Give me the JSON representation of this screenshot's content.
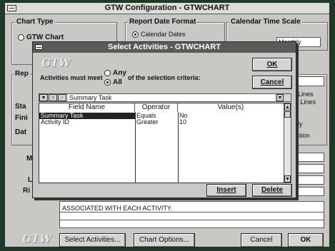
{
  "main_window": {
    "title": "GTW Configuration - GTWCHART",
    "chart_type": {
      "label": "Chart Type",
      "option1": "GTW Chart"
    },
    "report_date_format": {
      "label": "Report Date Format",
      "option1": "Calendar Dates"
    },
    "calendar_time_scale": {
      "label": "Calendar Time Scale",
      "time_units_value": "Monthly"
    },
    "partial_labels": {
      "rep": "Rep",
      "sta": "Sta",
      "fin": "Fini",
      "dat": "Dat",
      "ma": "Ma",
      "l": "L",
      "ri": "Ri",
      "lines": "Lines",
      "id_lines": "d Lines",
      "ly": "ly",
      "ation": "ation"
    },
    "note_text": "ASSOCIATED WITH EACH ACTIVITY.",
    "buttons": {
      "select_activities": "Select Activities...",
      "chart_options": "Chart Options...",
      "cancel": "Cancel",
      "ok": "OK"
    },
    "logo": "GTW"
  },
  "dialog": {
    "title": "Select Activities - GTWCHART",
    "logo": "GTW",
    "must_meet_label": "Activities must meet",
    "criteria_label": "of the selection criteria:",
    "radio_any": "Any",
    "radio_all": "All",
    "ok_button": "OK",
    "cancel_button": "Cancel",
    "edit_value": "Summary Task",
    "columns": [
      "Field Name",
      "Operator",
      "Value(s)"
    ],
    "rows": [
      {
        "field": "Summary Task",
        "operator": "Equals",
        "value": "No"
      },
      {
        "field": "Activity ID",
        "operator": "Greater",
        "value": "10"
      }
    ],
    "insert_button": "Insert",
    "delete_button": "Delete"
  }
}
